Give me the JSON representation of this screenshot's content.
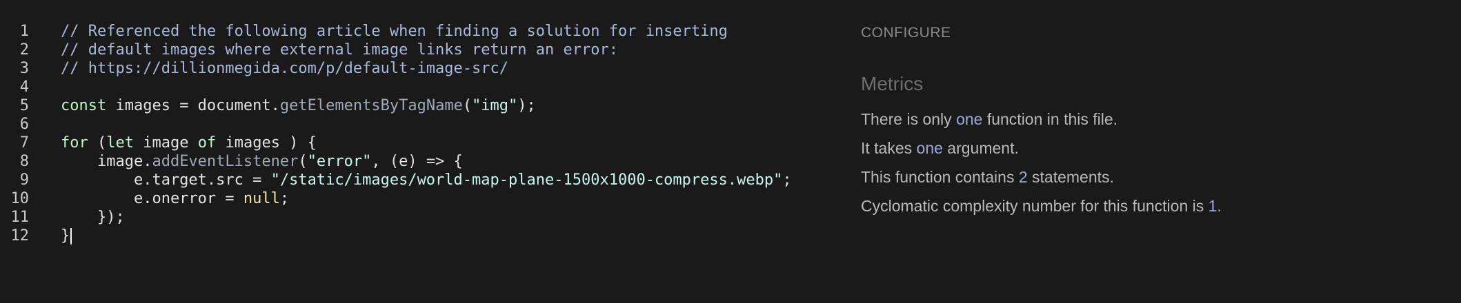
{
  "editor": {
    "lines": [
      {
        "num": "1",
        "tokens": [
          {
            "t": "// Referenced the following article when finding a solution for inserting",
            "c": "comment"
          }
        ]
      },
      {
        "num": "2",
        "tokens": [
          {
            "t": "// default images where external image links return an error:",
            "c": "comment"
          }
        ]
      },
      {
        "num": "3",
        "tokens": [
          {
            "t": "// https://dillionmegida.com/p/default-image-src/",
            "c": "comment"
          }
        ]
      },
      {
        "num": "4",
        "tokens": []
      },
      {
        "num": "5",
        "tokens": [
          {
            "t": "const",
            "c": "kw"
          },
          {
            "t": " images = document.",
            "c": "plain"
          },
          {
            "t": "getElementsByTagName",
            "c": "fn"
          },
          {
            "t": "(",
            "c": "plain"
          },
          {
            "t": "\"img\"",
            "c": "str"
          },
          {
            "t": ");",
            "c": "plain"
          }
        ]
      },
      {
        "num": "6",
        "tokens": []
      },
      {
        "num": "7",
        "tokens": [
          {
            "t": "for",
            "c": "kw"
          },
          {
            "t": " (",
            "c": "plain"
          },
          {
            "t": "let",
            "c": "kw"
          },
          {
            "t": " image ",
            "c": "plain"
          },
          {
            "t": "of",
            "c": "kw"
          },
          {
            "t": " images ) {",
            "c": "plain"
          }
        ]
      },
      {
        "num": "8",
        "tokens": [
          {
            "t": "    image.",
            "c": "plain"
          },
          {
            "t": "addEventListener",
            "c": "fn"
          },
          {
            "t": "(",
            "c": "plain"
          },
          {
            "t": "\"error\"",
            "c": "str"
          },
          {
            "t": ", (e) => {",
            "c": "plain"
          }
        ]
      },
      {
        "num": "9",
        "tokens": [
          {
            "t": "        e.target.src = ",
            "c": "plain"
          },
          {
            "t": "\"/static/images/world-map-plane-1500x1000-compress.webp\"",
            "c": "str"
          },
          {
            "t": ";",
            "c": "plain"
          }
        ]
      },
      {
        "num": "10",
        "tokens": [
          {
            "t": "        e.onerror = ",
            "c": "plain"
          },
          {
            "t": "null",
            "c": "null"
          },
          {
            "t": ";",
            "c": "plain"
          }
        ]
      },
      {
        "num": "11",
        "tokens": [
          {
            "t": "    });",
            "c": "plain"
          }
        ]
      },
      {
        "num": "12",
        "tokens": [
          {
            "t": "}",
            "c": "plain"
          }
        ],
        "caret": true
      }
    ]
  },
  "panel": {
    "configure_label": "CONFIGURE",
    "metrics_title": "Metrics",
    "metrics": [
      {
        "pre": "There is only ",
        "hl": "one",
        "post": " function in this file."
      },
      {
        "pre": "It takes ",
        "hl": "one",
        "post": " argument."
      },
      {
        "pre": "This function contains ",
        "hl": "2",
        "post": " statements."
      },
      {
        "pre": "Cyclomatic complexity number for this function is ",
        "hl": "1",
        "post": "."
      }
    ]
  },
  "colors": {
    "background": "#1a1a1a",
    "comment": "#a8b8d6",
    "keyword": "#bdf5c9",
    "string": "#c8f5ee",
    "function": "#9fa8b8",
    "null": "#f0e6a8",
    "metric_highlight": "#9fa8d8"
  }
}
